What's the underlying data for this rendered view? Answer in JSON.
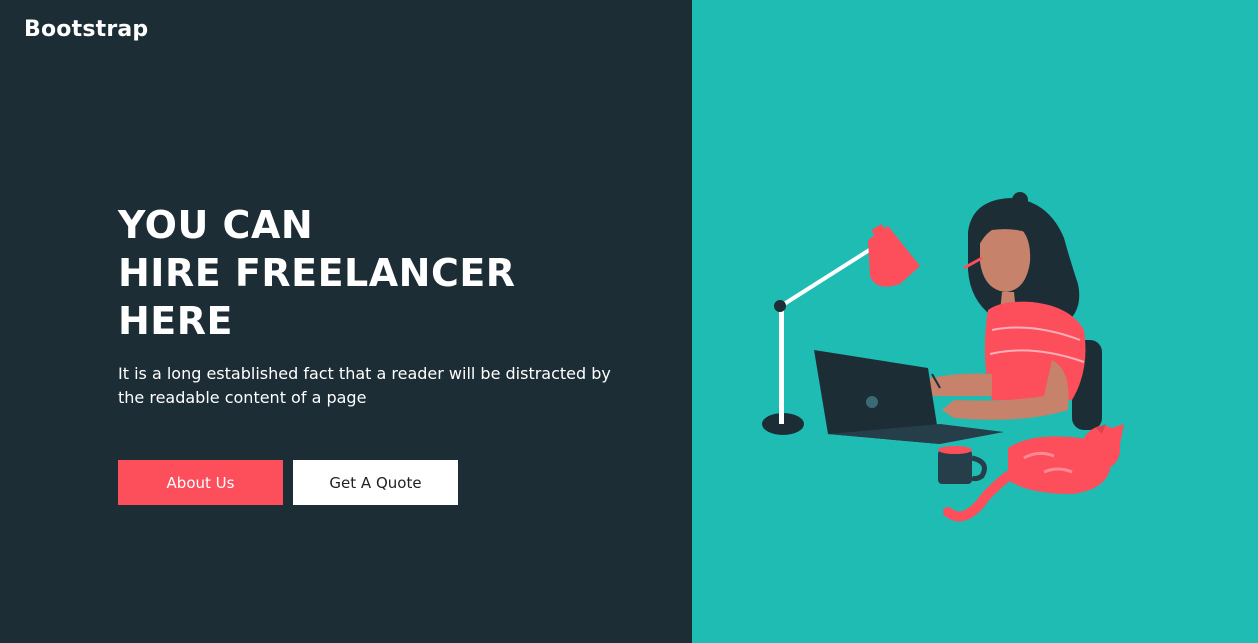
{
  "navbar": {
    "brand": "Bootstrap"
  },
  "hero": {
    "title_lines": [
      "YOU CAN",
      "HIRE FREELANCER",
      "HERE"
    ],
    "description": "It is a long established fact that a reader will be distracted by the readable content of a page",
    "buttons": {
      "about": "About Us",
      "quote": "Get A Quote"
    }
  },
  "colors": {
    "left_background": "#1c2d36",
    "right_background": "#1fbcb4",
    "accent": "#fd4e5c",
    "text": "#ffffff"
  },
  "illustration": {
    "icon": "woman-working-on-laptop-illustration"
  }
}
